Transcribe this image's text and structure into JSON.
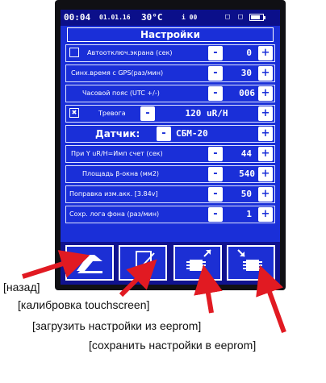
{
  "status_bar": {
    "time": "00:04",
    "date": "01.01.16",
    "temperature": "30°C",
    "indicator": "і 00",
    "sound_icon": "speaker-icon",
    "sd_icon": "sd-card-icon",
    "battery_level": 0.8
  },
  "title": "Настройки",
  "rows": {
    "screen_off": {
      "checked": false,
      "label": "Автоотключ.экрана (сек)",
      "minus": "-",
      "value": "0",
      "plus": "+"
    },
    "gps_sync": {
      "label": "Синх.время с GPS(раз/мин)",
      "minus": "-",
      "value": "30",
      "plus": "+"
    },
    "timezone": {
      "label": "Часовой пояс (UTC +/-)",
      "minus": "-",
      "value": "006",
      "plus": "+"
    },
    "alarm": {
      "checked": true,
      "label": "Тревога",
      "minus": "-",
      "value": "120 uR/H",
      "plus": "+"
    },
    "sensor": {
      "label": "Датчик:",
      "minus": "-",
      "value": "СБМ-20",
      "plus": "+"
    },
    "cpm": {
      "label": "При Y uR/H=Имп счет (сек)",
      "minus": "-",
      "value": "44",
      "plus": "+"
    },
    "beta_area": {
      "label": "Площадь β-окна (мм2)",
      "minus": "-",
      "value": "540",
      "plus": "+"
    },
    "battery_corr": {
      "label": "Поправка изм.акк. [3.84v]",
      "minus": "-",
      "value": "50",
      "plus": "+"
    },
    "bg_log": {
      "label": "Сохр. лога фона (раз/мин)",
      "minus": "-",
      "value": "1",
      "plus": "+"
    }
  },
  "toolbar": [
    {
      "icon": "back-arrow-icon"
    },
    {
      "icon": "touchscreen-calibration-icon"
    },
    {
      "icon": "chip-load-icon"
    },
    {
      "icon": "chip-save-icon"
    }
  ],
  "annotations": {
    "back": "[назад]",
    "calibration": "[калибровка touchscreen]",
    "load": "[загрузить настройки из eeprom]",
    "save": "[сохранить настройки в eeprom]"
  },
  "colors": {
    "screen_bg": "#1a2fd8",
    "bar_bg": "#0b0f8a",
    "arrow": "#e11a22"
  }
}
